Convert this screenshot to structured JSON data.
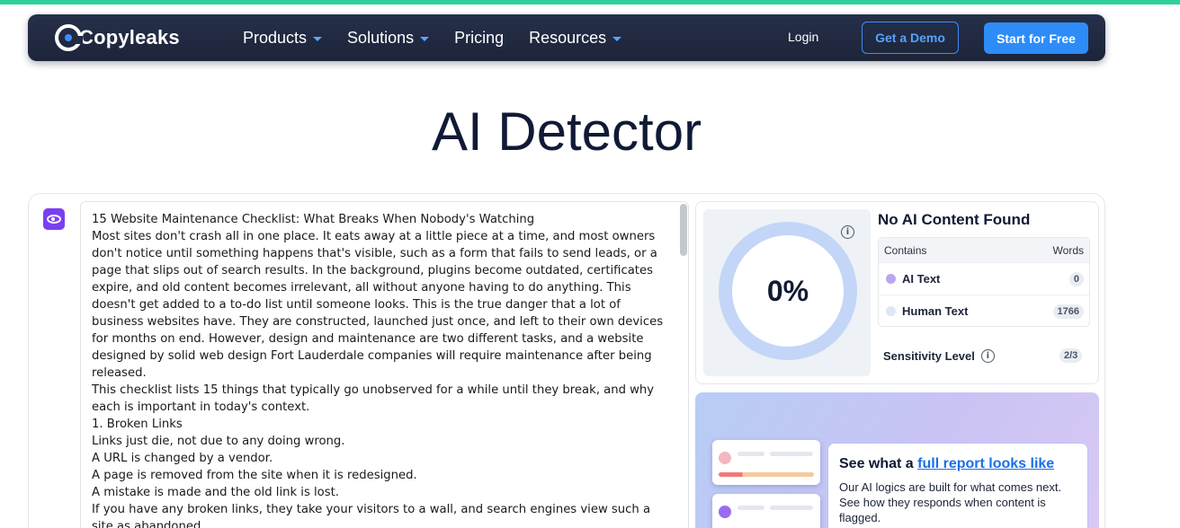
{
  "nav": {
    "logo_text": "Copyleaks",
    "items": [
      {
        "label": "Products",
        "has_dropdown": true
      },
      {
        "label": "Solutions",
        "has_dropdown": true
      },
      {
        "label": "Pricing",
        "has_dropdown": false
      },
      {
        "label": "Resources",
        "has_dropdown": true
      }
    ],
    "login": "Login",
    "demo": "Get a Demo",
    "start": "Start for Free"
  },
  "page": {
    "title": "AI Detector"
  },
  "editor": {
    "lines": [
      "15 Website Maintenance Checklist: What Breaks When Nobody's Watching",
      "Most sites don't crash all in one place. It eats away at a little piece at a time, and most owners don't notice until something happens that's visible, such as a form that fails to send leads, or a page that slips out of search results. In the background, plugins become outdated, certificates expire, and old content becomes irrelevant, all without anyone having to do anything. This doesn't get added to a to-do list until someone looks. This is the true danger that a lot of business websites have. They are constructed, launched just once, and left to their own devices for months on end. However, design and maintenance are two different tasks, and a website designed by solid web design Fort Lauderdale companies will require maintenance after being released.",
      "This checklist lists 15 things that typically go unobserved for a while until they break, and why each is important in today's context.",
      "1. Broken Links",
      "Links just die, not due to any doing wrong.",
      "A URL is changed by a vendor.",
      "A page is removed from the site when it is redesigned.",
      "A mistake is made and the old link is lost.",
      "If you have any broken links, they take your visitors to a wall, and search engines view such a site as abandoned."
    ]
  },
  "result": {
    "percent": "0%",
    "heading": "No AI Content Found",
    "table_header": {
      "contains": "Contains",
      "words": "Words"
    },
    "rows": [
      {
        "label": "AI Text",
        "count": "0",
        "color": "#b9a6ee"
      },
      {
        "label": "Human Text",
        "count": "1766",
        "color": "#dfe6f4"
      }
    ],
    "sensitivity_label": "Sensitivity Level",
    "sensitivity_value": "2/3",
    "info_glyph": "i"
  },
  "promo": {
    "title_prefix": "See what a ",
    "title_link": "full report looks like",
    "description": "Our AI logics are built for what comes next. See how they responds when content is flagged."
  },
  "colors": {
    "accent": "#2d8cf7",
    "nav_bg": "#1f2840",
    "top_bar": "#2fd19a",
    "eye_button": "#7a3ff0",
    "gauge_ring": "#c3d6f8"
  }
}
